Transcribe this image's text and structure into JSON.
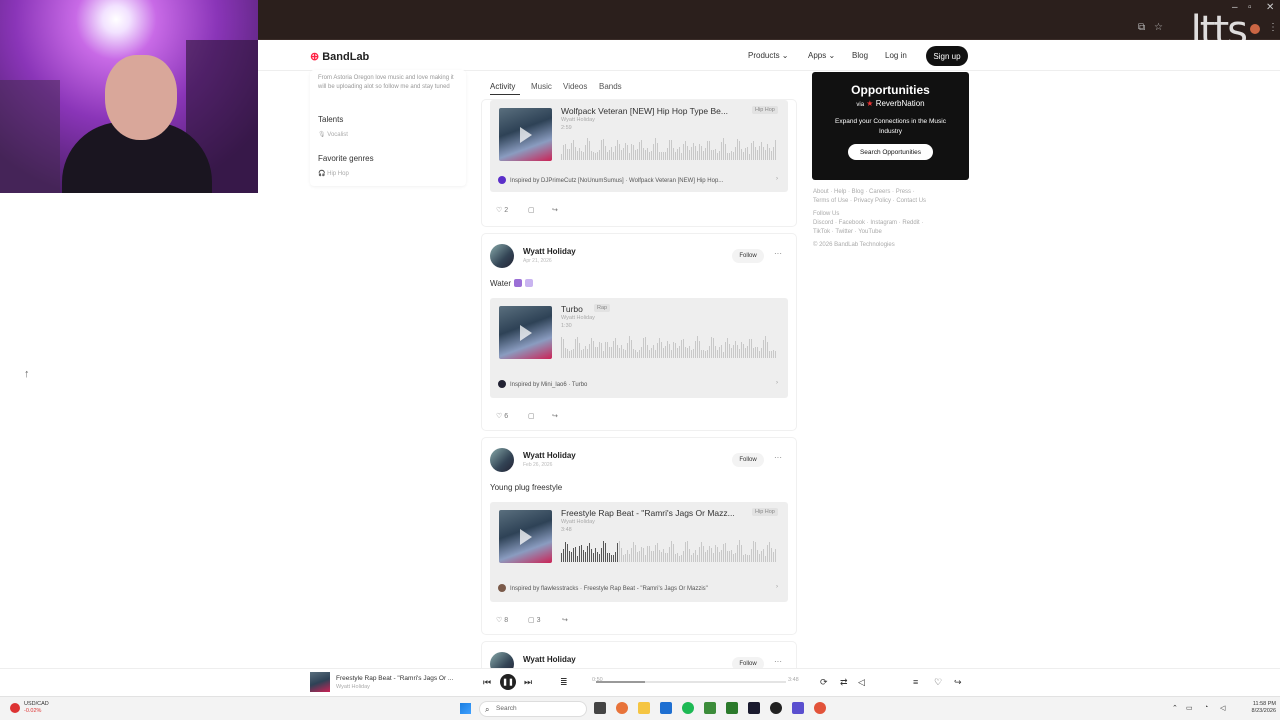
{
  "browser": {
    "overlay_logo": "ltts"
  },
  "site": {
    "logo": "BandLab",
    "nav": [
      "Products",
      "Apps",
      "Blog",
      "Log in"
    ],
    "signup": "Sign up"
  },
  "profile": {
    "bio": "From Astoria Oregon love music and love making it will be uploading alot so follow me and stay tuned",
    "talents_label": "Talents",
    "talents_value": "Vocalist",
    "genres_label": "Favorite genres",
    "genres_value": "Hip Hop"
  },
  "tabs": [
    "Activity",
    "Music",
    "Videos",
    "Bands"
  ],
  "posts": [
    {
      "track_title": "Wolfpack Veteran [NEW] Hip Hop Type Be...",
      "genre": "Hip Hop",
      "artist": "Wyatt Holiday",
      "duration": "2:59",
      "inspired": "Inspired by DJPrimeCutz [NoUnumSumus] · Wolfpack Veteran [NEW] Hip Hop...",
      "likes": "2",
      "comments": ""
    },
    {
      "author": "Wyatt Holiday",
      "date": "Apr 21, 2026",
      "follow": "Follow",
      "caption": "Water",
      "track_title": "Turbo",
      "genre": "Rap",
      "artist": "Wyatt Holiday",
      "duration": "1:30",
      "inspired": "Inspired by Mini_lao6 · Turbo",
      "likes": "6",
      "comments": ""
    },
    {
      "author": "Wyatt Holiday",
      "date": "Feb 26, 2026",
      "follow": "Follow",
      "caption": "Young plug freestyle",
      "track_title": "Freestyle Rap Beat - \"Ramri's Jags Or Mazz...",
      "genre": "Hip Hop",
      "artist": "Wyatt Holiday",
      "duration": "3:48",
      "inspired": "Inspired by flawlesstracks · Freestyle Rap Beat - \"Ramri's Jags Or Mazzis\"",
      "likes": "8",
      "comments": "3"
    },
    {
      "author": "Wyatt Holiday",
      "follow": "Follow"
    }
  ],
  "opportunities": {
    "title": "Opportunities",
    "via_prefix": "via",
    "via_brand": "ReverbNation",
    "desc": "Expand your Connections in the Music Industry",
    "button": "Search Opportunities"
  },
  "footer": {
    "line1": "About · Help · Blog · Careers · Press ·",
    "line2": "Terms of Use · Privacy Policy · Contact Us",
    "line3": "Follow Us",
    "line4": "Discord · Facebook · Instagram · Reddit ·",
    "line5": "TikTok · Twitter · YouTube",
    "line6": "© 2026 BandLab Technologies"
  },
  "player": {
    "title": "Freestyle Rap Beat - \"Ramri's Jags Or ...",
    "artist": "Wyatt Holiday",
    "current_time": "0:50",
    "total_time": "3:48",
    "progress": 0.26
  },
  "taskbar": {
    "ticker_pair": "USD/CAD",
    "ticker_change": "-0.02%",
    "search": "Search",
    "time": "11:58 PM",
    "date": "8/23/2026"
  },
  "colors": {
    "brand_red": "#ff2244",
    "opp_bg": "#111111",
    "chrome": "#2b1f1c"
  },
  "icons": [
    "heart-icon",
    "comment-icon",
    "share-icon",
    "play-icon",
    "prev-icon",
    "next-icon",
    "pause-icon",
    "search-icon",
    "up-arrow-icon",
    "more-icon"
  ]
}
